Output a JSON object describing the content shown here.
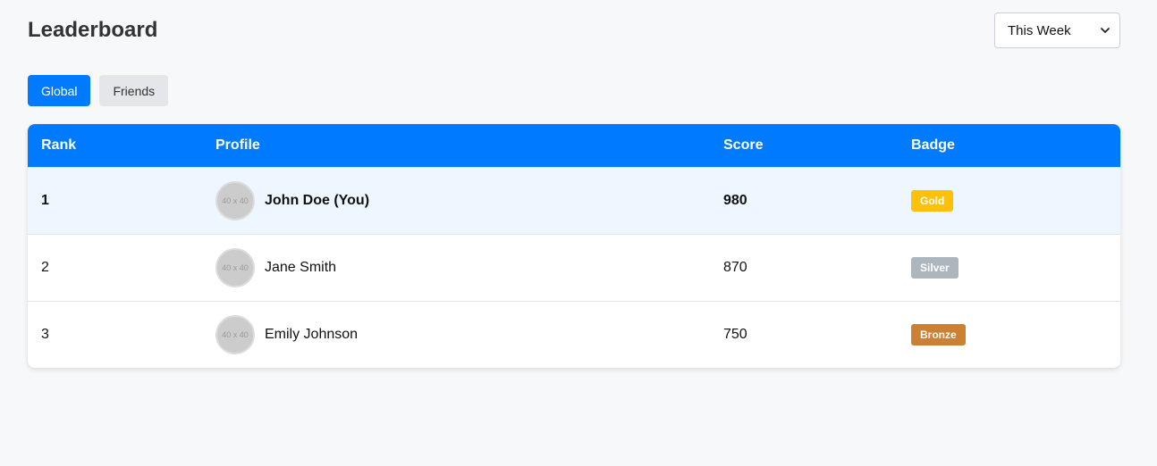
{
  "header": {
    "title": "Leaderboard",
    "period_select": {
      "selected": "This Week"
    }
  },
  "tabs": [
    {
      "label": "Global",
      "active": true
    },
    {
      "label": "Friends",
      "active": false
    }
  ],
  "table": {
    "columns": [
      "Rank",
      "Profile",
      "Score",
      "Badge"
    ],
    "rows": [
      {
        "rank": "1",
        "name": "John Doe (You)",
        "avatar": "40 x 40",
        "score": "980",
        "badge": "Gold",
        "badge_color": "#ffc107",
        "highlight": true
      },
      {
        "rank": "2",
        "name": "Jane Smith",
        "avatar": "40 x 40",
        "score": "870",
        "badge": "Silver",
        "badge_color": "#adb5bd",
        "highlight": false
      },
      {
        "rank": "3",
        "name": "Emily Johnson",
        "avatar": "40 x 40",
        "score": "750",
        "badge": "Bronze",
        "badge_color": "#cd7f32",
        "highlight": false
      }
    ]
  },
  "colors": {
    "accent": "#007bff",
    "highlight_row": "#eef6ff"
  }
}
